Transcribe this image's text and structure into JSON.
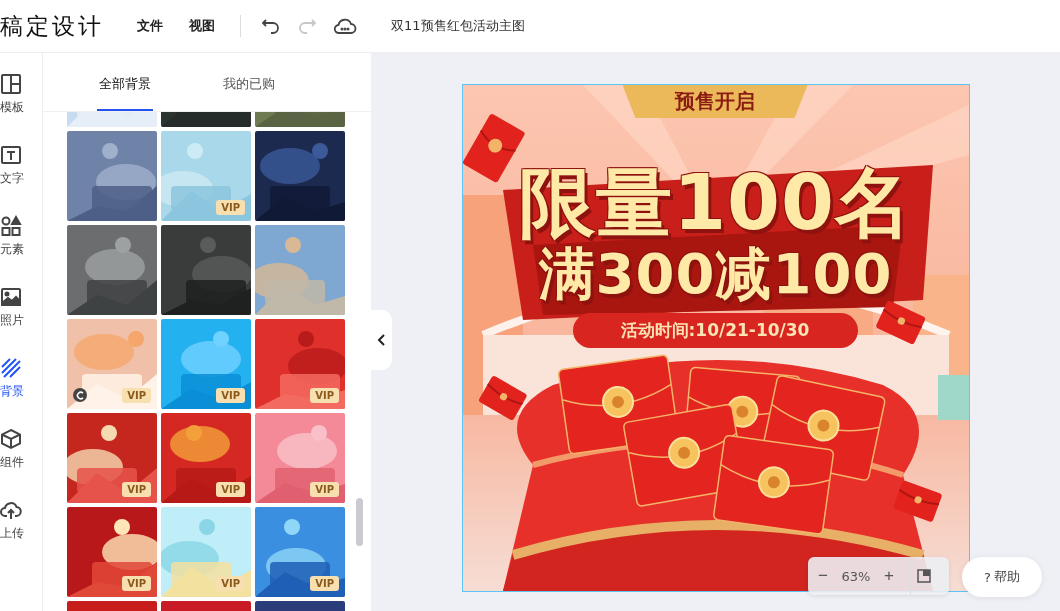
{
  "topbar": {
    "logo": "稿定设计",
    "menus": [
      "文件",
      "视图"
    ],
    "redo_disabled": true,
    "doc_title": "双11预售红包活动主图"
  },
  "rail": [
    {
      "label": "模板",
      "selected": false
    },
    {
      "label": "文字",
      "selected": false
    },
    {
      "label": "元素",
      "selected": false
    },
    {
      "label": "照片",
      "selected": false
    },
    {
      "label": "背景",
      "selected": true
    },
    {
      "label": "组件",
      "selected": false
    },
    {
      "label": "上传",
      "selected": false
    }
  ],
  "panel_tabs": [
    {
      "label": "全部背景",
      "selected": true
    },
    {
      "label": "我的已购",
      "selected": false
    }
  ],
  "thumbnails": [
    {
      "vip": false
    },
    {
      "vip": false
    },
    {
      "vip": false
    },
    {
      "vip": false
    },
    {
      "vip": true,
      "vip_label": "VIP"
    },
    {
      "vip": false
    },
    {
      "vip": false
    },
    {
      "vip": false
    },
    {
      "vip": false
    },
    {
      "vip": true,
      "vip_label": "VIP",
      "animated": true
    },
    {
      "vip": true,
      "vip_label": "VIP"
    },
    {
      "vip": true,
      "vip_label": "VIP"
    },
    {
      "vip": true,
      "vip_label": "VIP"
    },
    {
      "vip": true,
      "vip_label": "VIP"
    },
    {
      "vip": true,
      "vip_label": "VIP"
    },
    {
      "vip": true,
      "vip_label": "VIP"
    },
    {
      "vip": true,
      "vip_label": "VIP"
    },
    {
      "vip": true,
      "vip_label": "VIP"
    },
    {
      "vip": false
    },
    {
      "vip": false
    },
    {
      "vip": false
    }
  ],
  "poster": {
    "tag": "预售开启",
    "headline": "限量100名",
    "subhead": "满300减100",
    "date_pill": "活动时间:10/21-10/30"
  },
  "zoom": {
    "minus": "−",
    "value": "63%",
    "plus": "+"
  },
  "help": {
    "mark": "?",
    "label": "帮助"
  }
}
